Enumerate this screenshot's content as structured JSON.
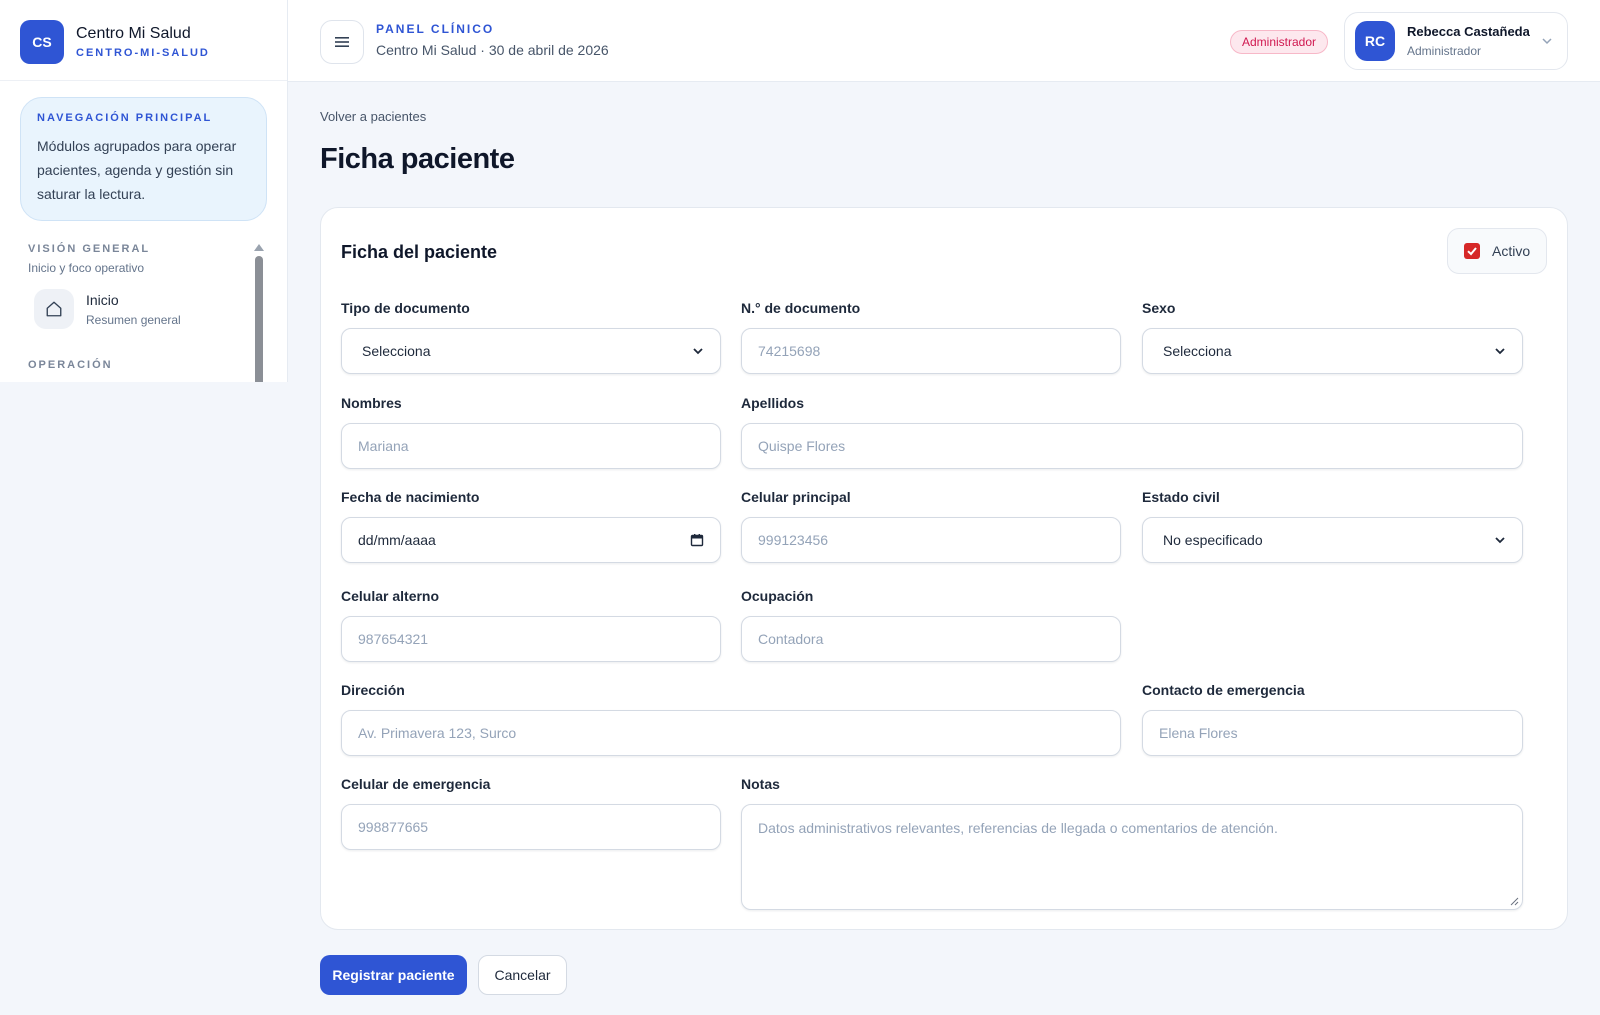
{
  "brand": {
    "logo": "CS",
    "name": "Centro Mi Salud",
    "slug": "CENTRO-MI-SALUD"
  },
  "sidebar": {
    "nav_card": {
      "title": "NAVEGACIÓN PRINCIPAL",
      "text": "Módulos agrupados para operar pacientes, agenda y gestión sin saturar la lectura."
    },
    "sections": [
      {
        "title": "VISIÓN GENERAL",
        "subtitle": "Inicio y foco operativo",
        "items": [
          {
            "label": "Inicio",
            "sub": "Resumen general",
            "icon": "home-icon"
          }
        ]
      },
      {
        "title": "OPERACIÓN"
      }
    ]
  },
  "header": {
    "eyebrow": "PANEL CLÍNICO",
    "subtitle": "Centro Mi Salud · 30 de abril de 2026",
    "role_badge": "Administrador",
    "user": {
      "initials": "RC",
      "name": "Rebecca Castañeda",
      "role": "Administrador"
    }
  },
  "main": {
    "back_link": "Volver a pacientes",
    "title": "Ficha paciente",
    "card_title": "Ficha del paciente",
    "active": {
      "label": "Activo",
      "checked": true
    },
    "fields": {
      "tipo_documento": {
        "label": "Tipo de documento",
        "value": "Selecciona"
      },
      "numero_documento": {
        "label": "N.° de documento",
        "placeholder": "74215698"
      },
      "sexo": {
        "label": "Sexo",
        "value": "Selecciona"
      },
      "nombres": {
        "label": "Nombres",
        "placeholder": "Mariana"
      },
      "apellidos": {
        "label": "Apellidos",
        "placeholder": "Quispe Flores"
      },
      "fecha_nacimiento": {
        "label": "Fecha de nacimiento",
        "value": "dd/mm/aaaa"
      },
      "celular_principal": {
        "label": "Celular principal",
        "placeholder": "999123456"
      },
      "estado_civil": {
        "label": "Estado civil",
        "value": "No especificado"
      },
      "celular_alterno": {
        "label": "Celular alterno",
        "placeholder": "987654321"
      },
      "ocupacion": {
        "label": "Ocupación",
        "placeholder": "Contadora"
      },
      "direccion": {
        "label": "Dirección",
        "placeholder": "Av. Primavera 123, Surco"
      },
      "contacto_emergencia": {
        "label": "Contacto de emergencia",
        "placeholder": "Elena Flores"
      },
      "celular_emergencia": {
        "label": "Celular de emergencia",
        "placeholder": "998877665"
      },
      "notas": {
        "label": "Notas",
        "placeholder": "Datos administrativos relevantes, referencias de llegada o comentarios de atención."
      }
    },
    "actions": {
      "submit": "Registrar paciente",
      "cancel": "Cancelar"
    }
  },
  "colors": {
    "accent": "#2f55d4",
    "checkbox": "#d62828",
    "badge_text": "#d01850"
  }
}
